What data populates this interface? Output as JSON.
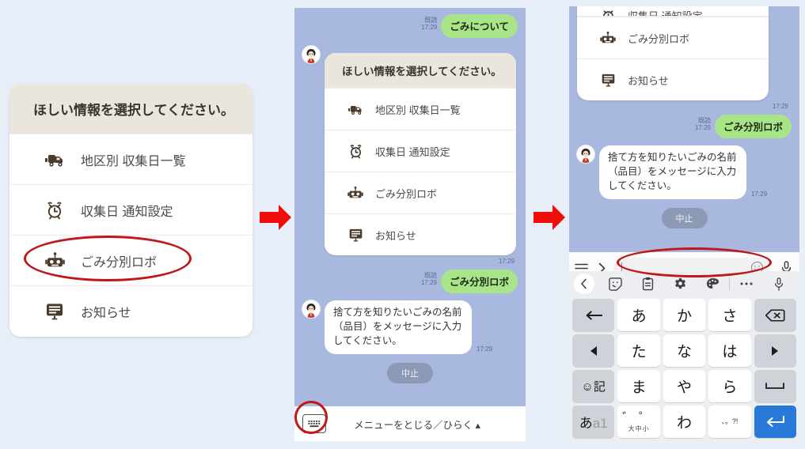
{
  "colors": {
    "page_bg": "#e8eef7",
    "chat_bg": "#a8b8de",
    "bubble_out": "#a8e588",
    "bubble_in": "#ffffff",
    "card_head": "#ebe6dd",
    "annotation": "#c01718",
    "arrow": "#f10c0c",
    "enter_key": "#2979d8"
  },
  "menu_card": {
    "header": "ほしい情報を選択してください。",
    "rows": [
      {
        "icon": "garbage-truck-icon",
        "label": "地区別 収集日一覧"
      },
      {
        "icon": "alarm-clock-icon",
        "label": "収集日 通知設定"
      },
      {
        "icon": "robot-icon",
        "label": "ごみ分別ロボ"
      },
      {
        "icon": "notice-board-icon",
        "label": "お知らせ"
      }
    ]
  },
  "panel_mid": {
    "outgoing_1": {
      "read_label": "既読",
      "time": "17:29",
      "text": "ごみについて"
    },
    "card_time": "17:29",
    "outgoing_2": {
      "read_label": "既読",
      "time": "17:29",
      "text": "ごみ分別ロボ"
    },
    "incoming": {
      "text": "捨て方を知りたいごみの名前（品目）をメッセージに入力してください。",
      "time": "17:29"
    },
    "quick_reply": "中止",
    "bottom_bar": {
      "keyboard_icon": "keyboard-icon",
      "menu_toggle_label": "メニューをとじる／ひらく ▴"
    }
  },
  "panel_right": {
    "card_rows": [
      {
        "icon": "robot-icon",
        "label": "ごみ分別ロボ"
      },
      {
        "icon": "notice-board-icon",
        "label": "お知らせ"
      }
    ],
    "clipped_row_label": "収集日 通知設定",
    "card_time": "17:29",
    "outgoing": {
      "read_label": "既読",
      "time": "17:29",
      "text": "ごみ分別ロボ"
    },
    "incoming": {
      "text": "捨て方を知りたいごみの名前（品目）をメッセージに入力してください。",
      "time": "17:29"
    },
    "quick_reply": "中止",
    "input_bar": {
      "menu_icon": "hamburger-menu-icon",
      "expand_icon": "chevron-right-icon",
      "placeholder": "",
      "value": "",
      "emoji_icon": "smiley-icon",
      "mic_icon": "microphone-icon"
    },
    "keyboard": {
      "toolbar": [
        "chevron-left-icon",
        "sticker-icon",
        "clipboard-icon",
        "gear-icon",
        "palette-icon",
        "ellipsis-icon",
        "microphone-icon"
      ],
      "rows": [
        [
          {
            "type": "fn",
            "icon": "undo-arrow-icon",
            "label": ""
          },
          {
            "type": "char",
            "label": "あ"
          },
          {
            "type": "char",
            "label": "か"
          },
          {
            "type": "char",
            "label": "さ"
          },
          {
            "type": "fn",
            "icon": "backspace-icon",
            "label": ""
          }
        ],
        [
          {
            "type": "fn",
            "icon": "caret-left-icon",
            "label": ""
          },
          {
            "type": "char",
            "label": "た"
          },
          {
            "type": "char",
            "label": "な"
          },
          {
            "type": "char",
            "label": "は"
          },
          {
            "type": "fn",
            "icon": "caret-right-icon",
            "label": ""
          }
        ],
        [
          {
            "type": "fn2",
            "label": "☺記"
          },
          {
            "type": "char",
            "label": "ま"
          },
          {
            "type": "char",
            "label": "や"
          },
          {
            "type": "char",
            "label": "ら"
          },
          {
            "type": "fn",
            "icon": "space-bar-icon",
            "label": ""
          }
        ],
        [
          {
            "type": "mode",
            "label": "あa1"
          },
          {
            "type": "dakuten",
            "top": "゛゜",
            "bottom": "大中小"
          },
          {
            "type": "char",
            "label": "わ"
          },
          {
            "type": "punct",
            "label": "、。?!"
          },
          {
            "type": "enter",
            "icon": "enter-arrow-icon",
            "label": ""
          }
        ]
      ]
    }
  },
  "arrows": [
    {
      "name": "flow-arrow-1"
    },
    {
      "name": "flow-arrow-2"
    }
  ]
}
